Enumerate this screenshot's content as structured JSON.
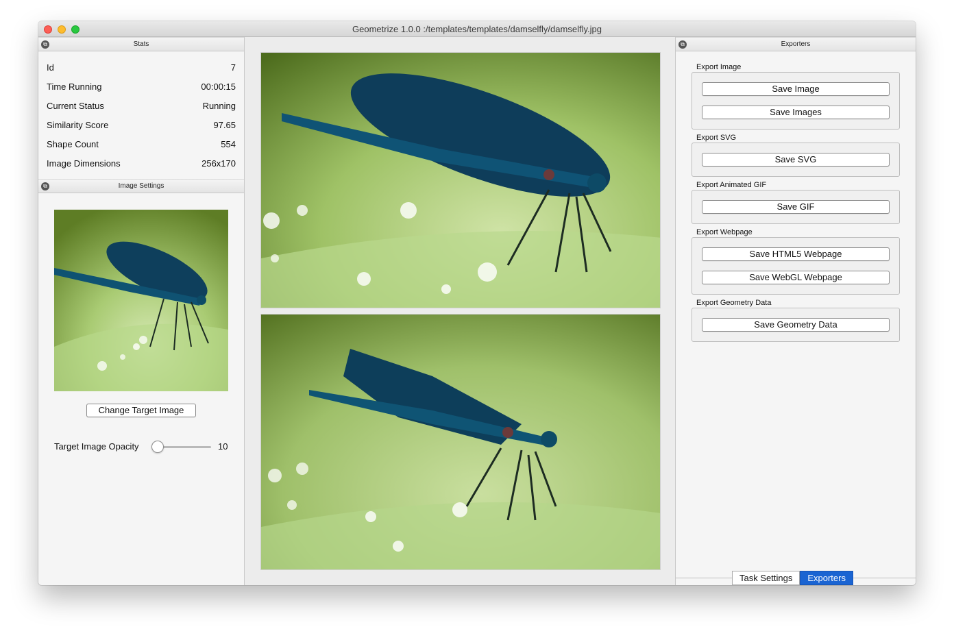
{
  "window": {
    "title": "Geometrize 1.0.0 :/templates/templates/damselfly/damselfly.jpg"
  },
  "stats_panel": {
    "title": "Stats",
    "rows": [
      {
        "label": "Id",
        "value": "7"
      },
      {
        "label": "Time Running",
        "value": "00:00:15"
      },
      {
        "label": "Current Status",
        "value": "Running"
      },
      {
        "label": "Similarity Score",
        "value": "97.65"
      },
      {
        "label": "Shape Count",
        "value": "554"
      },
      {
        "label": "Image Dimensions",
        "value": "256x170"
      }
    ]
  },
  "image_settings": {
    "title": "Image Settings",
    "change_button": "Change Target Image",
    "opacity_label": "Target Image Opacity",
    "opacity_value": "10"
  },
  "exporters_panel": {
    "title": "Exporters",
    "groups": [
      {
        "label": "Export Image",
        "buttons": [
          "Save Image",
          "Save Images"
        ]
      },
      {
        "label": "Export SVG",
        "buttons": [
          "Save SVG"
        ]
      },
      {
        "label": "Export Animated GIF",
        "buttons": [
          "Save GIF"
        ]
      },
      {
        "label": "Export Webpage",
        "buttons": [
          "Save HTML5 Webpage",
          "Save WebGL Webpage"
        ]
      },
      {
        "label": "Export Geometry Data",
        "buttons": [
          "Save Geometry Data"
        ]
      }
    ]
  },
  "tabs": [
    {
      "label": "Task Settings",
      "active": false
    },
    {
      "label": "Exporters",
      "active": true
    }
  ],
  "icons": {
    "dock_float": "dock-float-icon"
  },
  "colors": {
    "accent": "#1a64d2",
    "damselfly_body": "#0f4c66",
    "leaf_green": "#a6c86e"
  }
}
